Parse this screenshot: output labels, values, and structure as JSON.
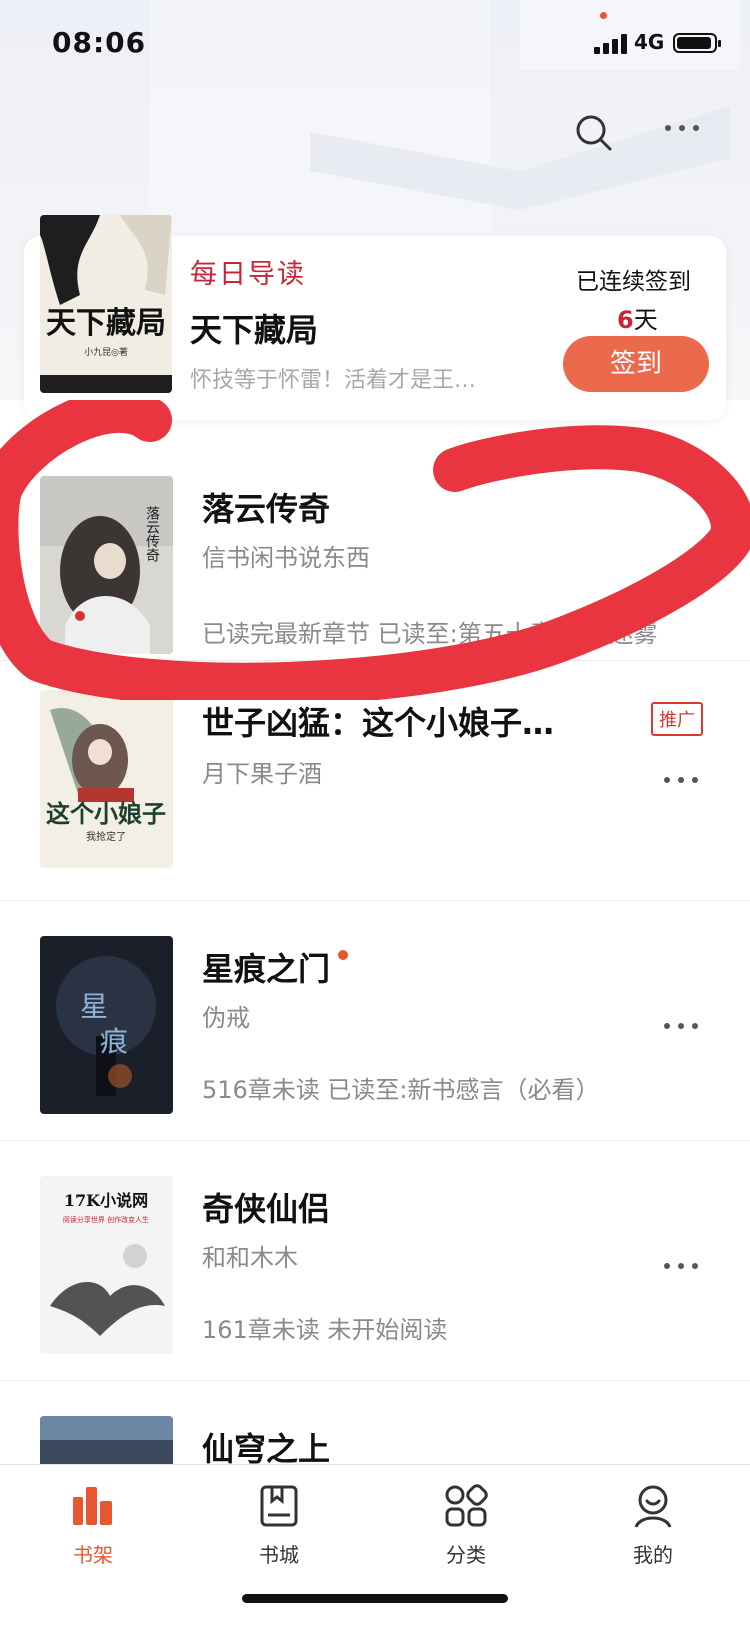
{
  "status_bar": {
    "time": "08:06",
    "network": "4G"
  },
  "header": {
    "search_icon": "search-icon",
    "more_icon": "more-dots-icon"
  },
  "daily": {
    "tag": "每日导读",
    "title": "天下藏局",
    "desc": "怀技等于怀雷！活着才是王…",
    "cover_title": "天下藏局",
    "cover_author": "小九昆◎著",
    "streak_label": "已连续签到",
    "streak_days": "6",
    "streak_unit": "天",
    "signin_label": "签到"
  },
  "books": [
    {
      "title": "落云传奇",
      "author": "信书闲书说东西",
      "progress": "已读完最新章节 已读至:第五十章 秦江迷雾",
      "cover_text": "落云传奇"
    },
    {
      "title": "世子凶猛：这个小娘子…",
      "author": "月下果子酒",
      "badge": "推广",
      "cover_text": "这个小娘子",
      "cover_sub": "我抢定了"
    },
    {
      "title": "星痕之门",
      "author": "伪戒",
      "progress": "516章未读 已读至:新书感言（必看）",
      "cover_text": "星痕之门"
    },
    {
      "title": "奇侠仙侣",
      "author": "和和木木",
      "progress": "161章未读 未开始阅读",
      "cover_text": "17K小说网",
      "cover_sub": "阅读分享世界 创作改变人生"
    },
    {
      "title": "仙穹之上",
      "author": ""
    }
  ],
  "tabs": [
    {
      "label": "书架",
      "icon": "bookshelf-icon"
    },
    {
      "label": "书城",
      "icon": "book-store-icon"
    },
    {
      "label": "分类",
      "icon": "category-icon"
    },
    {
      "label": "我的",
      "icon": "profile-icon"
    }
  ],
  "colors": {
    "accent": "#e8572f",
    "sign_button": "#ec6a4c",
    "tag_red": "#c8253b",
    "annotation": "#e8353f"
  }
}
